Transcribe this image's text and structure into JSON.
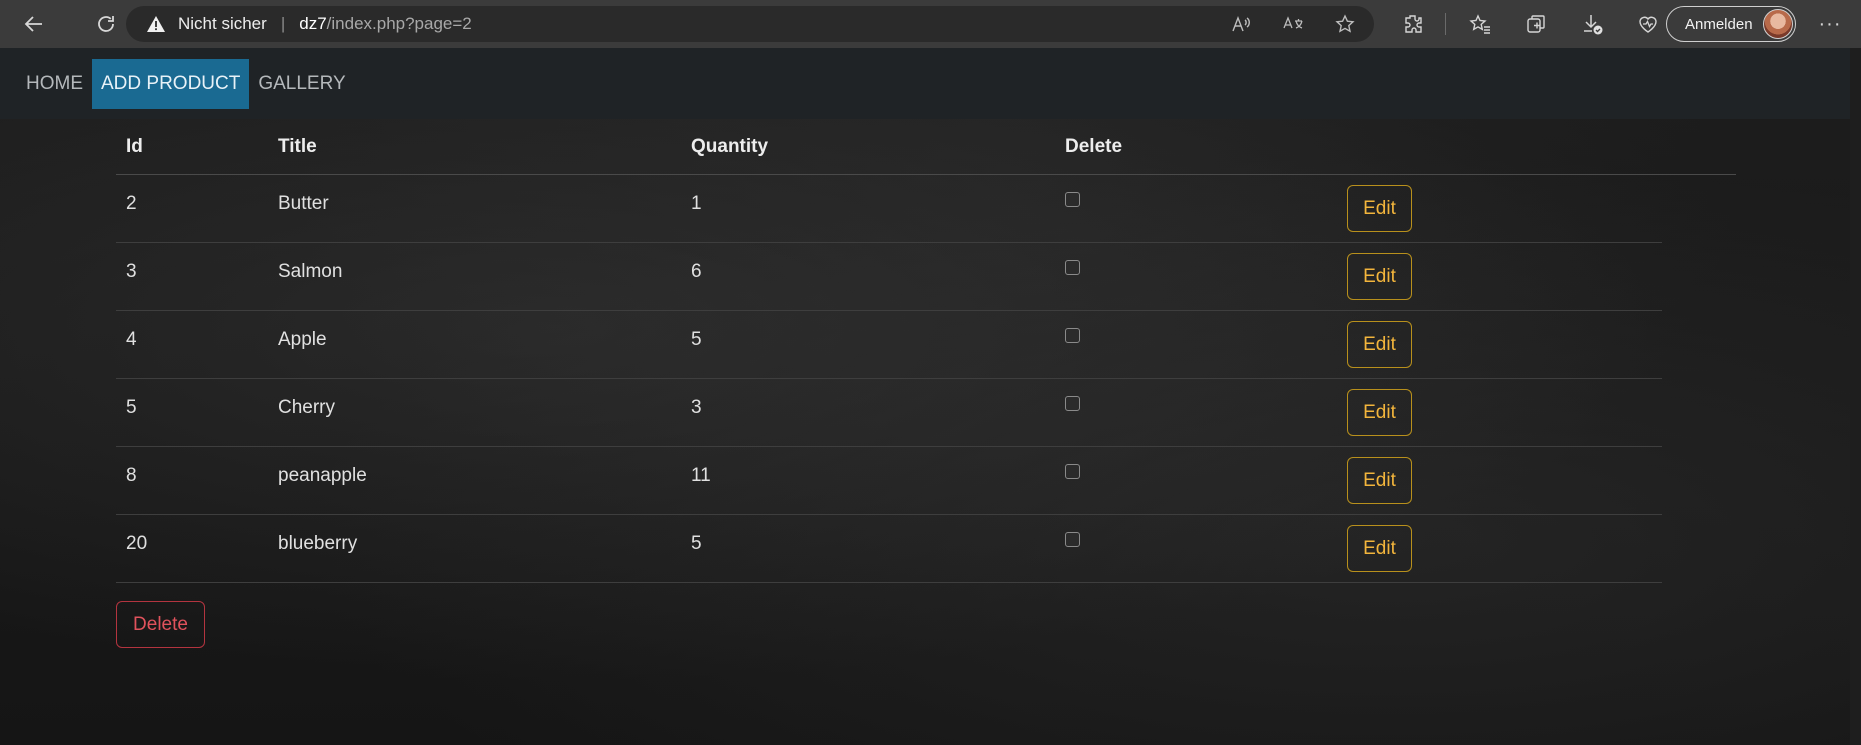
{
  "browser": {
    "security_label": "Nicht sicher",
    "url_host": "dz7",
    "url_path": "/index.php?page=2",
    "signin_label": "Anmelden"
  },
  "nav": {
    "items": [
      {
        "label": "HOME",
        "active": false
      },
      {
        "label": "ADD PRODUCT",
        "active": true
      },
      {
        "label": "GALLERY",
        "active": false
      }
    ]
  },
  "table": {
    "headers": {
      "id": "Id",
      "title": "Title",
      "quantity": "Quantity",
      "delete": "Delete"
    },
    "rows": [
      {
        "id": "2",
        "title": "Butter",
        "quantity": "1"
      },
      {
        "id": "3",
        "title": "Salmon",
        "quantity": "6"
      },
      {
        "id": "4",
        "title": "Apple",
        "quantity": "5"
      },
      {
        "id": "5",
        "title": "Cherry",
        "quantity": "3"
      },
      {
        "id": "8",
        "title": "peanapple",
        "quantity": "11"
      },
      {
        "id": "20",
        "title": "blueberry",
        "quantity": "5"
      }
    ],
    "edit_label": "Edit",
    "delete_button_label": "Delete"
  },
  "colors": {
    "nav_active": "#1a6a92",
    "edit_accent": "#f3b53c",
    "delete_accent": "#e0525c"
  }
}
